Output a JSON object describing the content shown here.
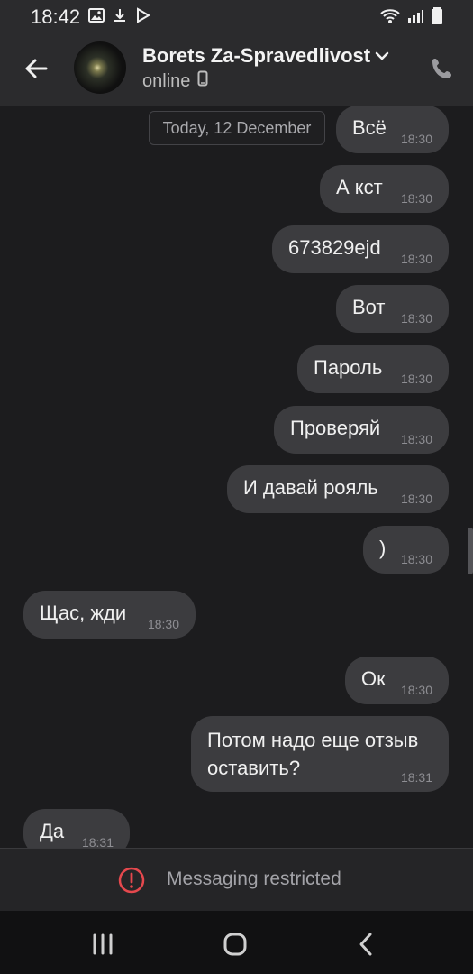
{
  "status_bar": {
    "time": "18:42"
  },
  "header": {
    "contact_name": "Borets Za-Spravedlivost",
    "status": "online"
  },
  "chat": {
    "date_label": "Today, 12 December",
    "messages": [
      {
        "text": "Всё",
        "time": "18:30",
        "from": "me"
      },
      {
        "text": "А кст",
        "time": "18:30",
        "from": "me"
      },
      {
        "text": "673829ejd",
        "time": "18:30",
        "from": "me"
      },
      {
        "text": "Вот",
        "time": "18:30",
        "from": "me"
      },
      {
        "text": "Пароль",
        "time": "18:30",
        "from": "me"
      },
      {
        "text": "Проверяй",
        "time": "18:30",
        "from": "me"
      },
      {
        "text": "И давай рояль",
        "time": "18:30",
        "from": "me"
      },
      {
        "text": ")",
        "time": "18:30",
        "from": "me"
      },
      {
        "text": "Щас, жди",
        "time": "18:30",
        "from": "them"
      },
      {
        "text": "Ок",
        "time": "18:30",
        "from": "me"
      },
      {
        "text": "Потом надо еще отзыв оставить?",
        "time": "18:31",
        "from": "me"
      },
      {
        "text": "Да",
        "time": "18:31",
        "from": "them"
      }
    ]
  },
  "footer": {
    "restricted_text": "Messaging restricted"
  },
  "colors": {
    "background": "#1c1c1e",
    "header": "#2b2b2d",
    "bubble": "#3c3c3f",
    "alert_red": "#e5484d"
  },
  "icons": {
    "status_left": [
      "image-icon",
      "download-icon",
      "play-store-icon"
    ],
    "status_right": [
      "wifi-icon",
      "signal-icon",
      "battery-icon"
    ],
    "header": [
      "back-arrow-icon",
      "chevron-down-icon",
      "phone-icon",
      "mobile-device-icon"
    ],
    "footer": [
      "alert-circle-icon"
    ],
    "nav": [
      "recent-apps-icon",
      "home-icon",
      "back-icon"
    ]
  }
}
